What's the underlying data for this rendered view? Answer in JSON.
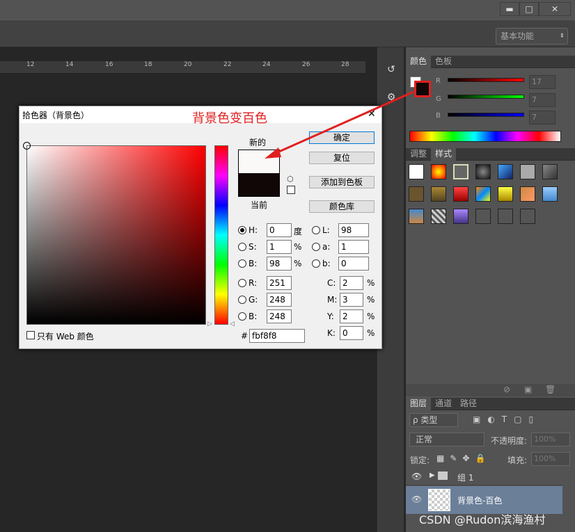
{
  "window": {
    "minimize": "▬",
    "maximize": "□",
    "close": "✕"
  },
  "workspace": {
    "label": "基本功能"
  },
  "ruler": {
    "ticks": [
      "12",
      "14",
      "16",
      "18",
      "20",
      "22",
      "24",
      "26",
      "28"
    ]
  },
  "annotation": {
    "text": "背景色变百色",
    "color": "#e02020"
  },
  "color_panel": {
    "tabs": [
      "颜色",
      "色板"
    ],
    "r_label": "R",
    "g_label": "G",
    "b_label": "B",
    "r_value": "17",
    "g_value": "7",
    "b_value": "7"
  },
  "styles_panel": {
    "tabs": [
      "调整",
      "样式"
    ]
  },
  "layers_panel": {
    "tabs": [
      "图层",
      "通道",
      "路径"
    ],
    "filter_label": "ρ 类型",
    "blend_mode": "正常",
    "opacity_label": "不透明度:",
    "opacity_value": "100%",
    "lock_label": "锁定:",
    "fill_label": "填充:",
    "fill_value": "100%",
    "layers": [
      {
        "name": "组 1"
      },
      {
        "name": "背景色-百色"
      }
    ]
  },
  "watermark": "CSDN @Rudon滨海渔村",
  "dialog": {
    "title": "拾色器（背景色）",
    "close": "✕",
    "new_label": "新的",
    "current_label": "当前",
    "new_color": "#fbf8f8",
    "current_color": "#110707",
    "buttons": {
      "ok": "确定",
      "reset": "复位",
      "add": "添加到色板",
      "library": "颜色库"
    },
    "fields": {
      "H": {
        "label": "H:",
        "value": "0",
        "unit": "度"
      },
      "S": {
        "label": "S:",
        "value": "1",
        "unit": "%"
      },
      "Bv": {
        "label": "B:",
        "value": "98",
        "unit": "%"
      },
      "R": {
        "label": "R:",
        "value": "251"
      },
      "G": {
        "label": "G:",
        "value": "248"
      },
      "B": {
        "label": "B:",
        "value": "248"
      },
      "L": {
        "label": "L:",
        "value": "98"
      },
      "a": {
        "label": "a:",
        "value": "1"
      },
      "b": {
        "label": "b:",
        "value": "0"
      },
      "C": {
        "label": "C:",
        "value": "2",
        "unit": "%"
      },
      "M": {
        "label": "M:",
        "value": "3",
        "unit": "%"
      },
      "Y": {
        "label": "Y:",
        "value": "2",
        "unit": "%"
      },
      "K": {
        "label": "K:",
        "value": "0",
        "unit": "%"
      }
    },
    "hex_label": "#",
    "hex_value": "fbf8f8",
    "web_only_label": "只有 Web 颜色"
  }
}
